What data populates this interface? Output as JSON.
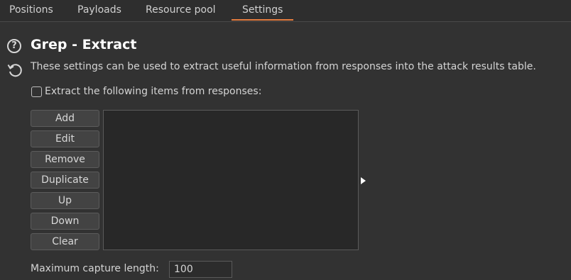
{
  "tabs": [
    {
      "label": "Positions",
      "active": false
    },
    {
      "label": "Payloads",
      "active": false
    },
    {
      "label": "Resource pool",
      "active": false
    },
    {
      "label": "Settings",
      "active": true
    }
  ],
  "section": {
    "title": "Grep - Extract",
    "description": "These settings can be used to extract useful information from responses into the attack results table.",
    "icons": [
      "help-icon",
      "restore-defaults-icon"
    ]
  },
  "extract": {
    "checkbox_label": "Extract the following items from responses:",
    "checked": false,
    "buttons": [
      "Add",
      "Edit",
      "Remove",
      "Duplicate",
      "Up",
      "Down",
      "Clear"
    ],
    "items": []
  },
  "capture": {
    "label": "Maximum capture length:",
    "value": "100"
  },
  "colors": {
    "background": "#323232",
    "accent": "#e37c3f"
  }
}
